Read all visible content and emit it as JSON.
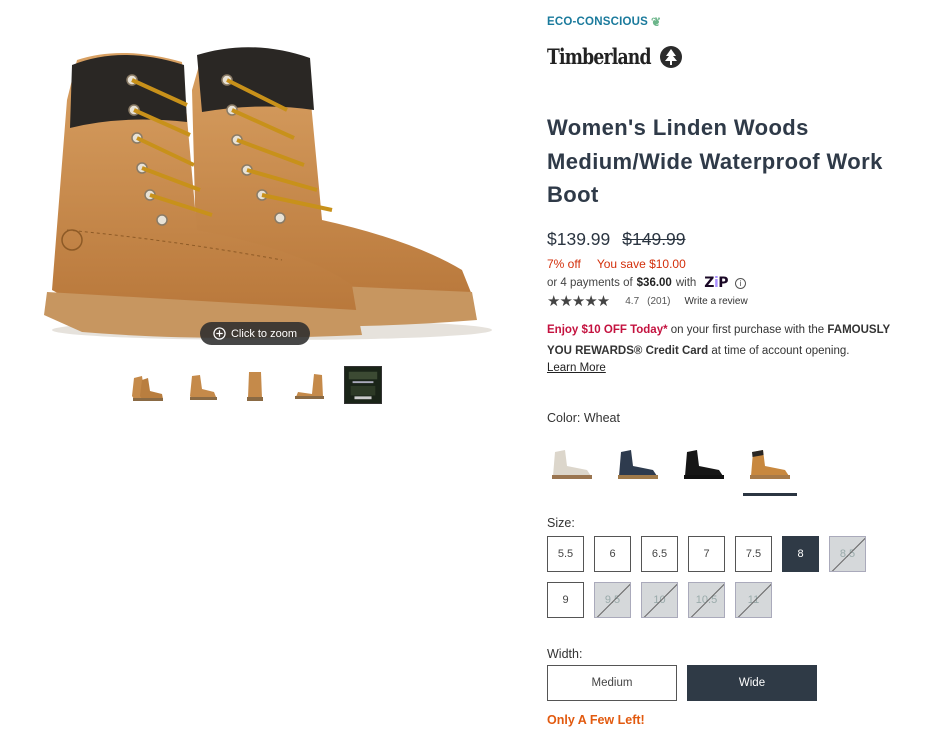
{
  "gallery": {
    "zoom_label": "Click to zoom",
    "thumbnails": [
      "boot-pair-side-thumb",
      "boot-single-thumb",
      "boot-front-thumb",
      "boot-side-thumb",
      "video-thumb"
    ]
  },
  "product": {
    "eco_label": "ECO-CONSCIOUS",
    "brand": "Timberland",
    "title": "Women's Linden Woods Medium/Wide Waterproof Work Boot"
  },
  "pricing": {
    "price": "$139.99",
    "was": "$149.99",
    "percent_off": "7% off",
    "savings": "You save $10.00",
    "installments_prefix": "or 4 payments of",
    "installment_amount": "$36.00",
    "installments_suffix": "with",
    "zip_logo_a": "Z",
    "zip_logo_b": "i",
    "zip_logo_c": "P",
    "info_glyph": "i"
  },
  "rating": {
    "stars": "★★★★★",
    "value": "4.7",
    "count": "(201)",
    "write_review": "Write a review"
  },
  "promo": {
    "highlight": "Enjoy $10 OFF Today*",
    "text1": " on your first purchase with the ",
    "card": "FAMOUSLY YOU REWARDS® Credit Card",
    "text2": " at time of account opening.",
    "learn_more": "Learn More"
  },
  "color": {
    "label": "Color: Wheat",
    "swatches": [
      "white",
      "navy",
      "black",
      "wheat"
    ],
    "selected": "wheat"
  },
  "size": {
    "label": "Size:",
    "options": [
      {
        "label": "5.5",
        "state": "available"
      },
      {
        "label": "6",
        "state": "available"
      },
      {
        "label": "6.5",
        "state": "available"
      },
      {
        "label": "7",
        "state": "available"
      },
      {
        "label": "7.5",
        "state": "available"
      },
      {
        "label": "8",
        "state": "selected"
      },
      {
        "label": "8.5",
        "state": "unavailable"
      },
      {
        "label": "9",
        "state": "available"
      },
      {
        "label": "9.5",
        "state": "unavailable"
      },
      {
        "label": "10",
        "state": "unavailable"
      },
      {
        "label": "10.5",
        "state": "unavailable"
      },
      {
        "label": "11",
        "state": "unavailable"
      }
    ]
  },
  "width": {
    "label": "Width:",
    "options": [
      "Medium",
      "Wide"
    ],
    "selected": "Wide"
  },
  "stock_message": "Only A Few Left!",
  "colors": {
    "accent_dark": "#2f3a46",
    "sale_red": "#d32f0b",
    "stock_orange": "#e25a0f",
    "promo_red": "#c4123f",
    "eco_blue": "#1a7a9c"
  }
}
